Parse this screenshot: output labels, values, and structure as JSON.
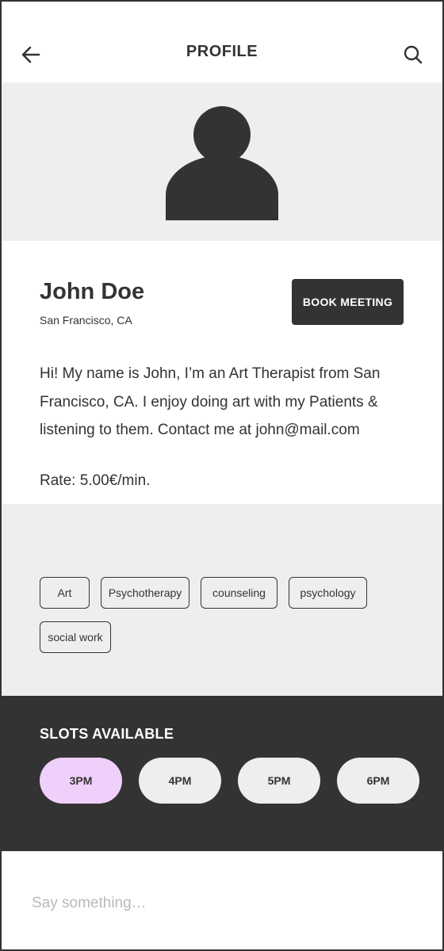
{
  "header": {
    "title": "PROFILE",
    "back_icon": "arrow-left-icon",
    "search_icon": "search-icon"
  },
  "profile": {
    "avatar_icon": "user-avatar-icon",
    "name": "John Doe",
    "location": "San Francisco, CA",
    "book_button_label": "BOOK MEETING",
    "bio": "Hi! My name is John, I’m an Art Therapist from San Francisco, CA. I enjoy doing art with my Patients & listening to them. Contact me at john@mail.com",
    "rate": "Rate: 5.00€/min."
  },
  "tags": [
    "Art",
    "Psychotherapy",
    "counseling",
    "psychology",
    "social work"
  ],
  "slots": {
    "title": "SLOTS AVAILABLE",
    "times": [
      "3PM",
      "4PM",
      "5PM",
      "6PM"
    ],
    "selected": "3PM"
  },
  "message": {
    "placeholder": "Say something…",
    "value": ""
  },
  "colors": {
    "dark": "#333333",
    "light_bg": "#f0eeed",
    "selected_slot": "#efd0fb",
    "white": "#ffffff"
  }
}
